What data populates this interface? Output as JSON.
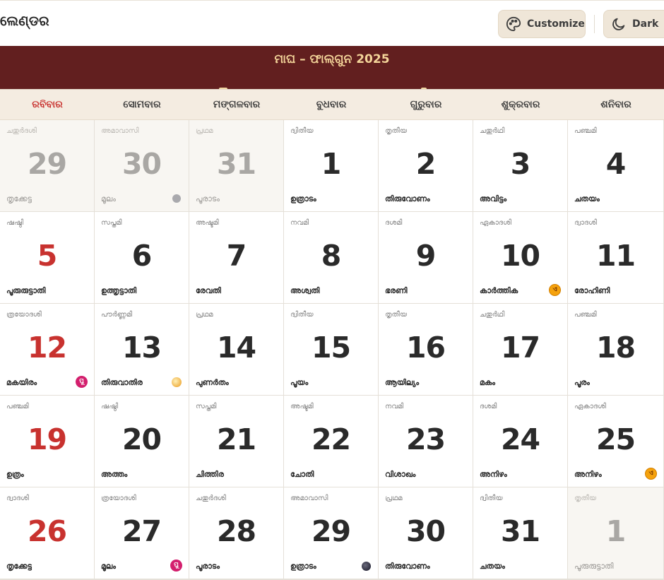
{
  "header": {
    "app_title": "ଲେଣ୍ଡର",
    "customize_label": "Customize",
    "dark_label": "Dark"
  },
  "banner": {
    "month_title": "ମାଘ – ଫାଲ୍‌ଗୁନ 2025"
  },
  "weekdays": [
    "ରବିବାର",
    "ସୋମବାର",
    "ମଙ୍ଗଳବାର",
    "ବୁଧବାର",
    "ଗୁରୁବାର",
    "ଶୁକ୍ରବାର",
    "ଶନିବାର"
  ],
  "colors": {
    "banner": "#621f1f",
    "banner_text": "#f4d59a",
    "sunday": "#c8322f",
    "header_bg": "#f4ece1"
  },
  "cells": [
    {
      "tithi": "ചതുർദശി",
      "day": "29",
      "nak": "തൃക്കേട്ട",
      "out": true
    },
    {
      "tithi": "അമാവാസി",
      "day": "30",
      "nak": "മൂലം",
      "out": true,
      "badge": "grey"
    },
    {
      "tithi": "പ്രഥമ",
      "day": "31",
      "nak": "പൂരാടം",
      "out": true
    },
    {
      "tithi": "ദ്വിതീയ",
      "day": "1",
      "nak": "ഉത്രാടം"
    },
    {
      "tithi": "തൃതീയ",
      "day": "2",
      "nak": "തിരുവോണം"
    },
    {
      "tithi": "ചതുർഥി",
      "day": "3",
      "nak": "അവിട്ടം"
    },
    {
      "tithi": "പഞ്ചമി",
      "day": "4",
      "nak": "ചതയം"
    },
    {
      "tithi": "ഷഷ്ഠി",
      "day": "5",
      "nak": "പൂരുരുട്ടാതി"
    },
    {
      "tithi": "സപ്തമി",
      "day": "6",
      "nak": "ഉത്തൃട്ടാതി"
    },
    {
      "tithi": "അഷ്ടമി",
      "day": "7",
      "nak": "രേവതി"
    },
    {
      "tithi": "നവമി",
      "day": "8",
      "nak": "അശ്വതി"
    },
    {
      "tithi": "ദശമി",
      "day": "9",
      "nak": "ഭരണി"
    },
    {
      "tithi": "ഏകാദശി",
      "day": "10",
      "nak": "കാർത്തിക",
      "badge": "ekadashi",
      "badge_text": "ଏ"
    },
    {
      "tithi": "ദ്വാദശി",
      "day": "11",
      "nak": "രോഹിണി"
    },
    {
      "tithi": "ത്രയോദശി",
      "day": "12",
      "nak": "മകയിരം",
      "badge": "purple",
      "badge_text": "ପୁ"
    },
    {
      "tithi": "പൗർണ്ണമി",
      "day": "13",
      "nak": "തിരുവാതിര",
      "badge": "fullmoon"
    },
    {
      "tithi": "പ്രഥമ",
      "day": "14",
      "nak": "പുണർതം"
    },
    {
      "tithi": "ദ്വിതീയ",
      "day": "15",
      "nak": "പൂയം"
    },
    {
      "tithi": "തൃതീയ",
      "day": "16",
      "nak": "ആയില്യം"
    },
    {
      "tithi": "ചതുർഥി",
      "day": "17",
      "nak": "മകം"
    },
    {
      "tithi": "പഞ്ചമി",
      "day": "18",
      "nak": "പൂരം"
    },
    {
      "tithi": "പഞ്ചമി",
      "day": "19",
      "nak": "ഉത്രം"
    },
    {
      "tithi": "ഷഷ്ഠി",
      "day": "20",
      "nak": "അത്തം"
    },
    {
      "tithi": "സപ്തമി",
      "day": "21",
      "nak": "ചിത്തിര"
    },
    {
      "tithi": "അഷ്ടമി",
      "day": "22",
      "nak": "ചോതി"
    },
    {
      "tithi": "നവമി",
      "day": "23",
      "nak": "വിശാഖം"
    },
    {
      "tithi": "ദശമി",
      "day": "24",
      "nak": "അനിഴം"
    },
    {
      "tithi": "ഏകാദശി",
      "day": "25",
      "nak": "അനിഴം",
      "badge": "ekadashi",
      "badge_text": "ଏ"
    },
    {
      "tithi": "ദ്വാദശി",
      "day": "26",
      "nak": "തൃക്കേട്ട"
    },
    {
      "tithi": "ത്രയോദശി",
      "day": "27",
      "nak": "മൂലം",
      "badge": "purple",
      "badge_text": "ପୁ"
    },
    {
      "tithi": "ചതുർദശി",
      "day": "28",
      "nak": "പൂരാടം"
    },
    {
      "tithi": "അമാവാസി",
      "day": "29",
      "nak": "ഉത്രാടം",
      "badge": "newmoon"
    },
    {
      "tithi": "പ്രഥമ",
      "day": "30",
      "nak": "തിരുവോണം"
    },
    {
      "tithi": "ദ്വിതീയ",
      "day": "31",
      "nak": "ചതയം"
    },
    {
      "tithi": "തൃതീയ",
      "day": "1",
      "nak": "പൂരുരുട്ടാതി",
      "out": true
    }
  ]
}
